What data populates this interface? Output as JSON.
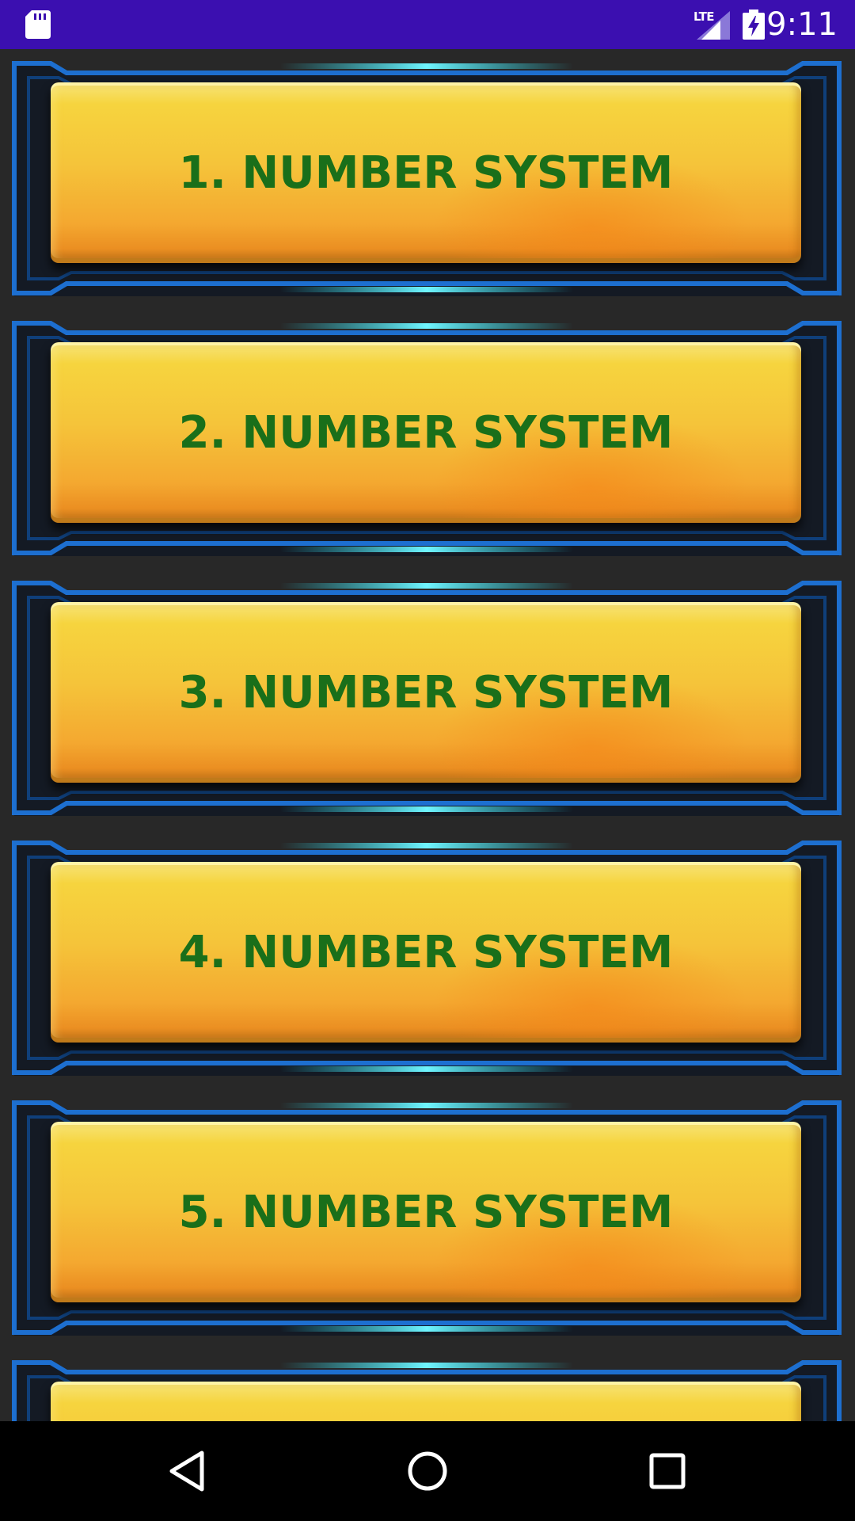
{
  "status_bar": {
    "network_label": "LTE",
    "time": "9:11",
    "background": "#3b0fb0"
  },
  "icons": {
    "sd_card": "sd-card-icon",
    "signal": "signal-icon",
    "battery": "battery-charging-icon",
    "back": "back-icon",
    "home": "home-icon",
    "recents": "recents-icon"
  },
  "menu": {
    "items": [
      {
        "label": "1. NUMBER SYSTEM"
      },
      {
        "label": "2. NUMBER SYSTEM"
      },
      {
        "label": "3. NUMBER SYSTEM"
      },
      {
        "label": "4. NUMBER SYSTEM"
      },
      {
        "label": "5. NUMBER SYSTEM"
      },
      {
        "label": ""
      }
    ]
  },
  "colors": {
    "button_text": "#1a6f1a",
    "gold": "#f5c43a",
    "frame_blue": "#1d6fd0",
    "glow_cyan": "#23e1f5"
  }
}
